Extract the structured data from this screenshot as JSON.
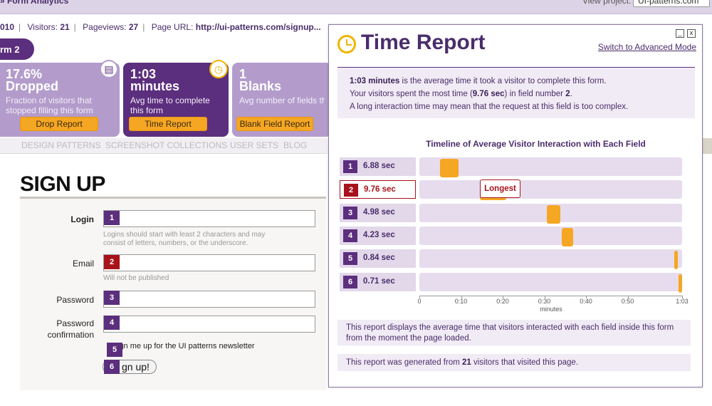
{
  "topbar": {
    "title": "» Form Analytics",
    "view_project_label": "View project:",
    "view_project_value": "UI-patterns.com"
  },
  "stats": {
    "date": "010",
    "visitors_label": "Visitors:",
    "visitors": "21",
    "pageviews_label": "Pageviews:",
    "pageviews": "27",
    "url_label": "Page URL:",
    "url": "http://ui-patterns.com/signup..."
  },
  "form_tab": "rm 2",
  "cards": [
    {
      "big1": "17.6%",
      "big2": "Dropped",
      "desc": "Fraction of visitors that stopped filling this form",
      "button": "Drop Report"
    },
    {
      "big1": "1:03",
      "big2": "minutes",
      "desc": "Avg time to complete this form",
      "button": "Time Report"
    },
    {
      "big1": "1",
      "big2": "Blanks",
      "desc": "Avg number of fields that were left blank",
      "button": "Blank Field Report"
    }
  ],
  "nav": [
    "DESIGN PATTERNS",
    "SCREENSHOT COLLECTIONS",
    "USER SETS",
    "BLOG"
  ],
  "signup": {
    "title": "SIGN UP",
    "login_label": "Login",
    "login_hint": "Logins should start with least 2 characters and may consist of letters, numbers, or the underscore.",
    "email_label": "Email",
    "email_hint": "Will not be published",
    "password_label": "Password",
    "password_confirm_label": "Password confirmation",
    "newsletter_label": "ign me up for the UI patterns newsletter",
    "submit_label": "gn up!",
    "field_numbers": [
      "1",
      "2",
      "3",
      "4",
      "5",
      "6"
    ]
  },
  "time_report": {
    "title": "Time Report",
    "switch_link": "Switch to Advanced Mode",
    "minimize": "_",
    "close": "x",
    "summary_time": "1:03 minutes",
    "summary_line1_rest": " is the average time it took a visitor to complete this form.",
    "summary_line2_pre": "Your visitors spent the most time (",
    "summary_line2_time": "9.76 sec",
    "summary_line2_mid": ") in field number ",
    "summary_line2_num": "2",
    "summary_line2_end": ".",
    "summary_line3": "A long interaction time may mean that the request at this field is too complex.",
    "chart_title": "Timeline of Average Visitor Interaction with Each Field",
    "longest_label": "Longest",
    "xlabel": "minutes",
    "note1": "This report displays the average time that visitors interacted with each field inside this form from the moment the page loaded.",
    "note2_pre": "This report was generated from ",
    "note2_count": "21",
    "note2_post": " visitors that visited this page."
  },
  "chart_data": {
    "type": "bar",
    "title": "Timeline of Average Visitor Interaction with Each Field",
    "xlabel": "minutes",
    "xlim": [
      0,
      63
    ],
    "xticks": [
      "0",
      "0:10",
      "0:20",
      "0:30",
      "0:40",
      "0:50",
      "1:03"
    ],
    "fields": [
      {
        "num": "1",
        "duration_label": "6.88 sec",
        "start_sec": 5,
        "duration_sec": 6.88
      },
      {
        "num": "2",
        "duration_label": "9.76 sec",
        "start_sec": 14.5,
        "duration_sec": 9.76,
        "longest": true
      },
      {
        "num": "3",
        "duration_label": "4.98 sec",
        "start_sec": 30.5,
        "duration_sec": 4.98
      },
      {
        "num": "4",
        "duration_label": "4.23 sec",
        "start_sec": 34.2,
        "duration_sec": 4.23
      },
      {
        "num": "5",
        "duration_label": "0.84 sec",
        "start_sec": 61.2,
        "duration_sec": 0.84
      },
      {
        "num": "6",
        "duration_label": "0.71 sec",
        "start_sec": 62.2,
        "duration_sec": 0.71
      }
    ],
    "bar_color": "#f5a623"
  }
}
